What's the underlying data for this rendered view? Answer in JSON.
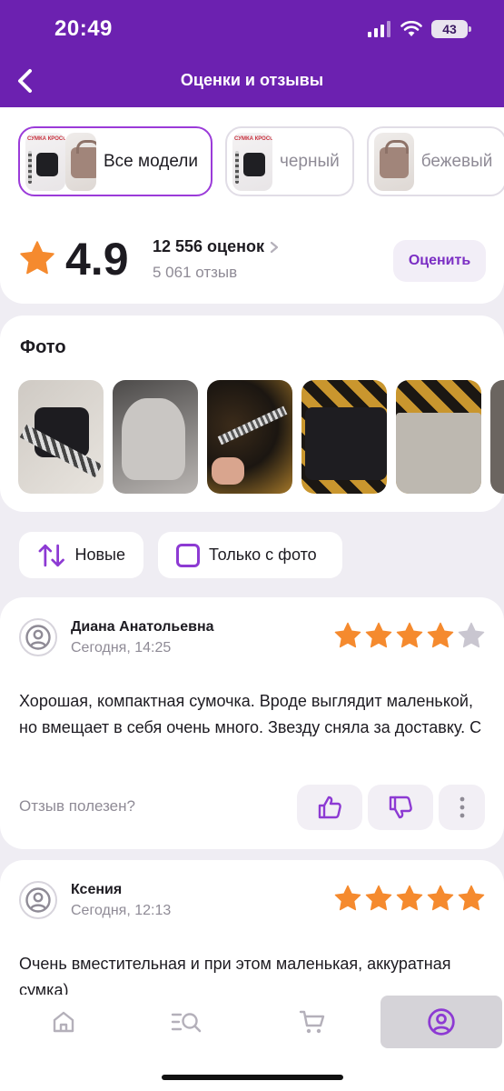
{
  "status_bar": {
    "time": "20:49",
    "battery": "43"
  },
  "header": {
    "title": "Оценки и отзывы"
  },
  "models": [
    {
      "label": "Все модели",
      "active": true
    },
    {
      "label": "черный",
      "active": false
    },
    {
      "label": "бежевый",
      "active": false
    }
  ],
  "thumb_text": "СУМКА КРОСС-БОДИ",
  "rating": {
    "value": "4.9",
    "count": "12 556 оценок",
    "reviews": "5 061 отзыв",
    "rate_button": "Оценить"
  },
  "photos": {
    "title": "Фото"
  },
  "filters": {
    "sort_label": "Новые",
    "photo_only_label": "Только с фото"
  },
  "reviews": [
    {
      "author": "Диана Анатольевна",
      "date": "Сегодня, 14:25",
      "stars": 4,
      "text": "Хорошая, компактная сумочка. Вроде выглядит маленькой, но вмещает в себя очень много. Звезду сняла за доставку. С",
      "helpful": "Отзыв полезен?"
    },
    {
      "author": "Ксения",
      "date": "Сегодня, 12:13",
      "stars": 5,
      "text": "Очень вместительная и при этом маленькая, аккуратная сумка)"
    }
  ],
  "colors": {
    "brand": "#6c21b0",
    "accent": "#9b3bd9",
    "star": "#f58a2e",
    "star_empty": "#c9c6d0"
  }
}
